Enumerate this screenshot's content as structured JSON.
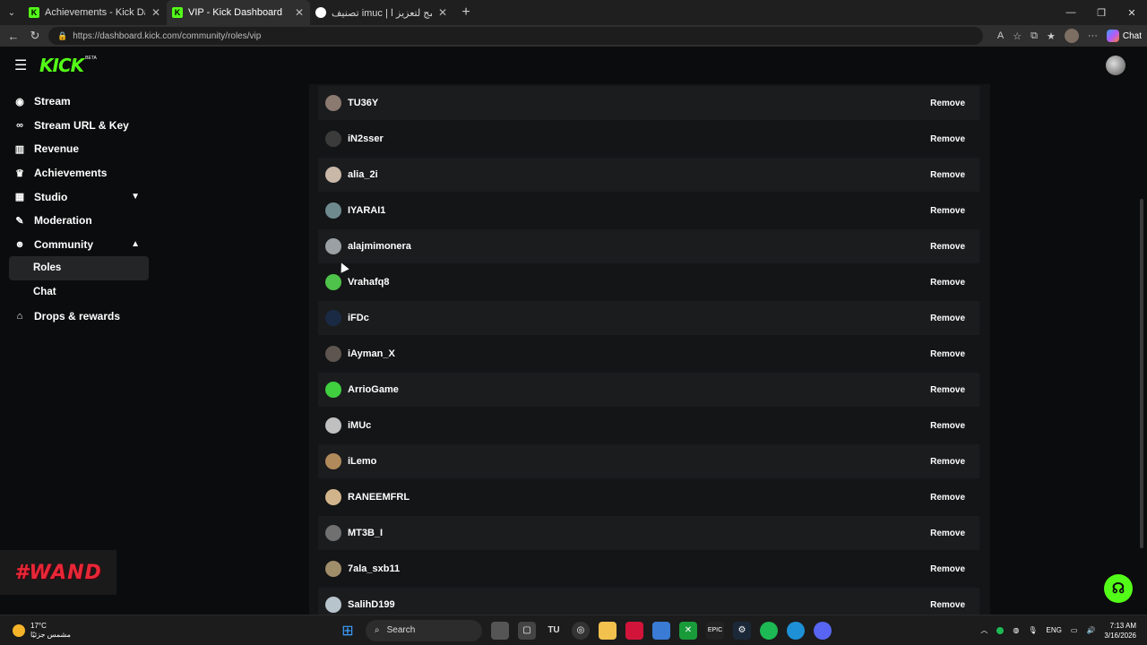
{
  "browser": {
    "tabs": [
      {
        "label": "Achievements - Kick Dashboard",
        "favicon": "K",
        "active": false
      },
      {
        "label": "VIP - Kick Dashboard",
        "favicon": "K",
        "active": true
      },
      {
        "label": "تصنيف imuc | أفضل برنامج لتعزيز ا...",
        "favicon": "",
        "active": false
      }
    ],
    "url": "https://dashboard.kick.com/community/roles/vip",
    "copilot_label": "Chat"
  },
  "header": {
    "logo": "KICK",
    "beta": "BETA"
  },
  "sidebar": {
    "items": [
      {
        "label": "Stream",
        "icon": "broadcast-icon",
        "glyph": "((·))"
      },
      {
        "label": "Stream URL & Key",
        "icon": "link-icon",
        "glyph": "⛓"
      },
      {
        "label": "Revenue",
        "icon": "chart-icon",
        "glyph": "▥"
      },
      {
        "label": "Achievements",
        "icon": "trophy-icon",
        "glyph": "🏆"
      },
      {
        "label": "Studio",
        "icon": "studio-icon",
        "glyph": "▦"
      },
      {
        "label": "Moderation",
        "icon": "wrench-icon",
        "glyph": "🔧"
      },
      {
        "label": "Community",
        "icon": "people-icon",
        "glyph": "👥"
      },
      {
        "label": "Drops & rewards",
        "icon": "gift-icon",
        "glyph": "🎁"
      }
    ],
    "community_sub": [
      {
        "label": "Roles",
        "active": true
      },
      {
        "label": "Chat",
        "active": false
      }
    ]
  },
  "vip_list": {
    "remove_label": "Remove",
    "users": [
      {
        "name": "TU36Y",
        "color": "#8a7a70"
      },
      {
        "name": "iN2sser",
        "color": "#3b3b3b"
      },
      {
        "name": "alia_2i",
        "color": "#c9b8a8"
      },
      {
        "name": "IYARAI1",
        "color": "#6e8a8f"
      },
      {
        "name": "alajmimonera",
        "color": "#9aa0a4"
      },
      {
        "name": "Vrahafq8",
        "color": "#4ec24a"
      },
      {
        "name": "iFDc",
        "color": "#1a2a44"
      },
      {
        "name": "iAyman_X",
        "color": "#5e5550"
      },
      {
        "name": "ArrioGame",
        "color": "#3fcf3f"
      },
      {
        "name": "iMUc",
        "color": "#c0c0c0"
      },
      {
        "name": "iLemo",
        "color": "#b08a5a"
      },
      {
        "name": "RANEEMFRL",
        "color": "#d2b48c"
      },
      {
        "name": "MT3B_I",
        "color": "#707070"
      },
      {
        "name": "7ala_sxb11",
        "color": "#a08d6a"
      },
      {
        "name": "SalihD199",
        "color": "#b7c4cc"
      }
    ]
  },
  "overlay": {
    "watermark": "#WAND"
  },
  "taskbar": {
    "weather_temp": "17°C",
    "weather_desc": "مشمس جزئيًا",
    "search_label": "Search",
    "lang": "ENG",
    "time": "7:13 AM",
    "date": "3/16/2026"
  },
  "colors": {
    "accent": "#53fc18",
    "background": "#0b0c0d"
  }
}
